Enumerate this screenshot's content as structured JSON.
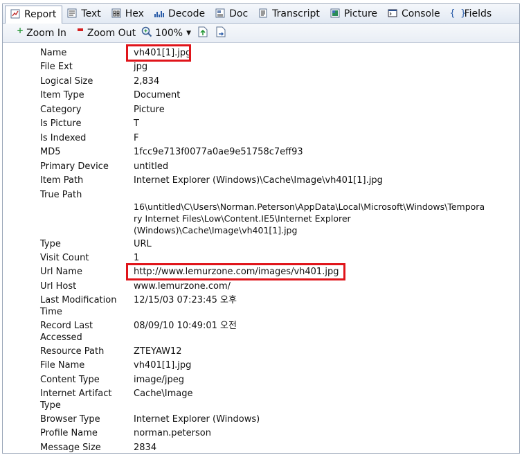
{
  "tabs": [
    {
      "label": "Report",
      "icon": "report-icon"
    },
    {
      "label": "Text",
      "icon": "text-icon"
    },
    {
      "label": "Hex",
      "icon": "hex-icon"
    },
    {
      "label": "Decode",
      "icon": "decode-icon"
    },
    {
      "label": "Doc",
      "icon": "doc-icon"
    },
    {
      "label": "Transcript",
      "icon": "transcript-icon"
    },
    {
      "label": "Picture",
      "icon": "picture-icon"
    },
    {
      "label": "Console",
      "icon": "console-icon"
    },
    {
      "label": "Fields",
      "icon": "fields-icon"
    }
  ],
  "toolbar": {
    "zoom_in": "Zoom In",
    "zoom_out": "Zoom Out",
    "zoom_level": "100%"
  },
  "fields": [
    {
      "label": "Name",
      "value": "vh401[1].jpg"
    },
    {
      "label": "File Ext",
      "value": "jpg"
    },
    {
      "label": "Logical Size",
      "value": "2,834"
    },
    {
      "label": "Item Type",
      "value": "Document"
    },
    {
      "label": "Category",
      "value": "Picture"
    },
    {
      "label": "Is Picture",
      "value": "T"
    },
    {
      "label": "Is Indexed",
      "value": "F"
    },
    {
      "label": "MD5",
      "value": "1fcc9e713f0077a0ae9e51758c7eff93"
    },
    {
      "label": "Primary Device",
      "value": "untitled"
    },
    {
      "label": "Item Path",
      "value": "Internet Explorer (Windows)\\Cache\\Image\\vh401[1].jpg"
    },
    {
      "label": "True Path",
      "value": ""
    },
    {
      "label": "",
      "value": "16\\untitled\\C\\Users\\Norman.Peterson\\AppData\\Local\\Microsoft\\Windows\\Tempora\nry Internet Files\\Low\\Content.IE5\\Internet Explorer\n(Windows)\\Cache\\Image\\vh401[1].jpg"
    },
    {
      "label": "Type",
      "value": "URL"
    },
    {
      "label": "Visit Count",
      "value": "1"
    },
    {
      "label": "Url Name",
      "value": "http://www.lemurzone.com/images/vh401.jpg"
    },
    {
      "label": "Url Host",
      "value": "www.lemurzone.com/"
    },
    {
      "label": "Last Modification\nTime",
      "value": "12/15/03 07:23:45 오후"
    },
    {
      "label": "Record Last\nAccessed",
      "value": "08/09/10 10:49:01 오전"
    },
    {
      "label": "Resource Path",
      "value": "ZTEYAW12"
    },
    {
      "label": "File Name",
      "value": "vh401[1].jpg"
    },
    {
      "label": "Content Type",
      "value": "image/jpeg"
    },
    {
      "label": "Internet Artifact\nType",
      "value": "Cache\\Image"
    },
    {
      "label": "Browser Type",
      "value": "Internet Explorer (Windows)"
    },
    {
      "label": "Profile Name",
      "value": "norman.peterson"
    },
    {
      "label": "Message Size",
      "value": "2834"
    }
  ],
  "colors": {
    "highlight": "#e0141a",
    "accent": "#1d4f91"
  }
}
